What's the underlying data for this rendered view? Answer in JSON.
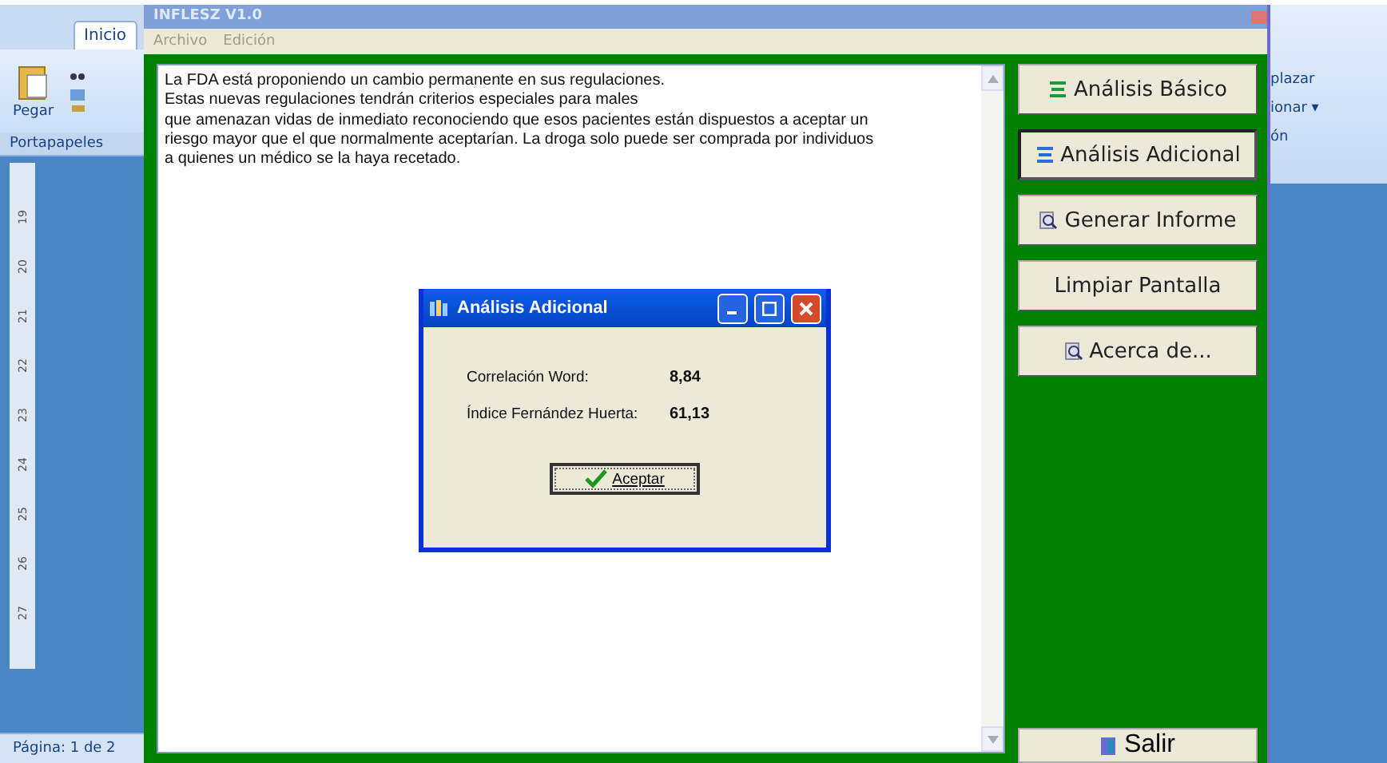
{
  "word_left": {
    "tab": "Inicio",
    "paste": "Pegar",
    "group": "Portapapeles",
    "ruler": [
      "19",
      "20",
      "21",
      "22",
      "23",
      "24",
      "25",
      "26",
      "27"
    ],
    "status": "Página: 1 de 2"
  },
  "word_right": {
    "items": [
      "plazar",
      "ionar ▾",
      "ón"
    ]
  },
  "window": {
    "title": "INFLESZ V1.0",
    "menu": [
      "Archivo",
      "Edición"
    ]
  },
  "text_lines": [
    "La FDA está proponiendo un cambio permanente en sus regulaciones.",
    "Estas nuevas regulaciones tendrán criterios especiales para males",
    "que amenazan vidas de inmediato reconociendo que esos pacientes están dispuestos a aceptar un",
    "riesgo mayor que el que normalmente aceptarían. La droga solo puede ser comprada por individuos",
    "a quienes un médico se la haya recetado."
  ],
  "buttons": [
    {
      "label": "Análisis Básico",
      "kind": "basic",
      "selected": false
    },
    {
      "label": "Análisis Adicional",
      "kind": "extra",
      "selected": true
    },
    {
      "label": "Generar Informe",
      "kind": "report",
      "selected": false
    },
    {
      "label": "Limpiar Pantalla",
      "kind": "plain",
      "selected": false
    },
    {
      "label": "Acerca de...",
      "kind": "about",
      "selected": false
    }
  ],
  "exit_button": "Salir",
  "dialog": {
    "title": "Análisis Adicional",
    "rows": [
      {
        "label": "Correlación Word:",
        "value": "8,84"
      },
      {
        "label": "Índice Fernández Huerta:",
        "value": "61,13"
      }
    ],
    "ok": "Aceptar"
  }
}
